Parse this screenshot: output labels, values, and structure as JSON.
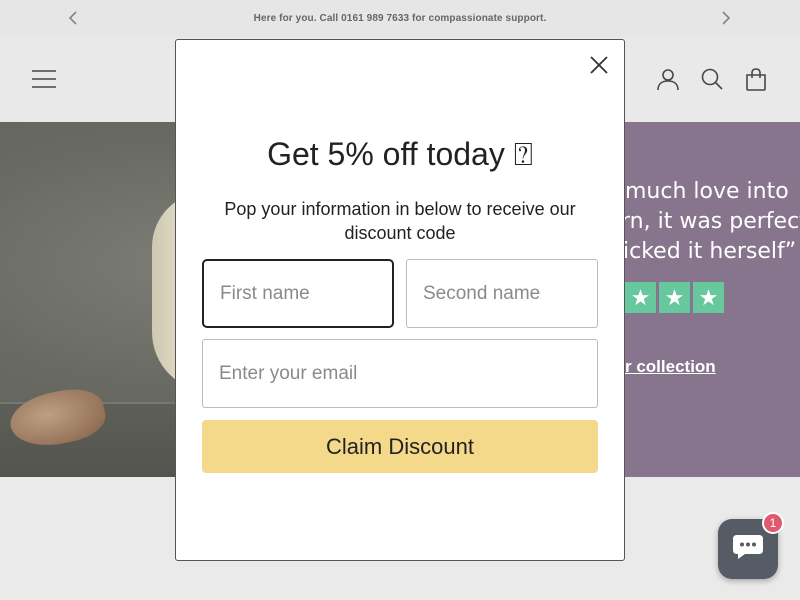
{
  "announcement": {
    "text": "Here for you. Call 0161 989 7633 for compassionate support."
  },
  "header": {
    "icons": [
      "menu-icon",
      "account-icon",
      "search-icon",
      "cart-icon"
    ]
  },
  "hero": {
    "quote_lines": [
      "much love into",
      "rn, it was perfect",
      "icked it herself”"
    ],
    "star_rating": 5,
    "collection_link": "r collection"
  },
  "modal": {
    "title": "Get 5% off today ⍰",
    "subtitle": "Pop your information in below to receive our discount code",
    "first_name_placeholder": "First name",
    "second_name_placeholder": "Second name",
    "email_placeholder": "Enter your email",
    "claim_label": "Claim Discount"
  },
  "chat": {
    "badge_count": "1"
  },
  "colors": {
    "accent_button": "#f5d98a",
    "hero_panel": "#7a6680",
    "star_green": "#56c293",
    "badge_red": "#e05a6f"
  }
}
